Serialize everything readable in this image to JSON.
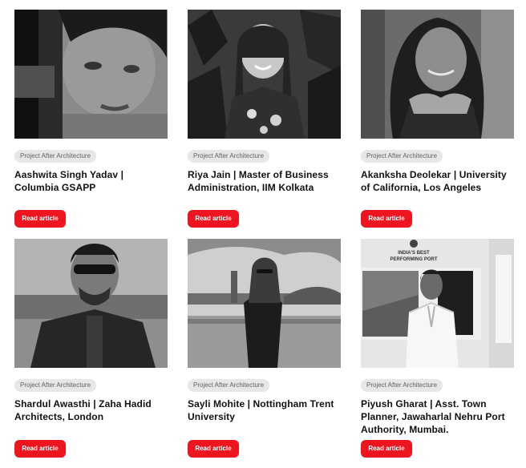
{
  "cards": [
    {
      "category": "Project After Architecture",
      "title": "Aashwita Singh Yadav | Columbia GSAPP",
      "button": "Read article"
    },
    {
      "category": "Project After Architecture",
      "title": "Riya Jain | Master of Business Administration, IIM Kolkata",
      "button": "Read article"
    },
    {
      "category": "Project After Architecture",
      "title": "Akanksha Deolekar | University of California, Los Angeles",
      "button": "Read article"
    },
    {
      "category": "Project After Architecture",
      "title": "Shardul Awasthi | Zaha Hadid Architects, London",
      "button": "Read article"
    },
    {
      "category": "Project After Architecture",
      "title": "Sayli Mohite | Nottingham Trent University",
      "button": "Read article"
    },
    {
      "category": "Project After Architecture",
      "title": "Piyush Gharat | Asst. Town Planner, Jawaharlal Nehru Port Authority, Mumbai.",
      "button": "Read article"
    }
  ],
  "photo_signage": {
    "line1": "INDIA'S BEST",
    "line2": "PERFORMING PORT"
  }
}
